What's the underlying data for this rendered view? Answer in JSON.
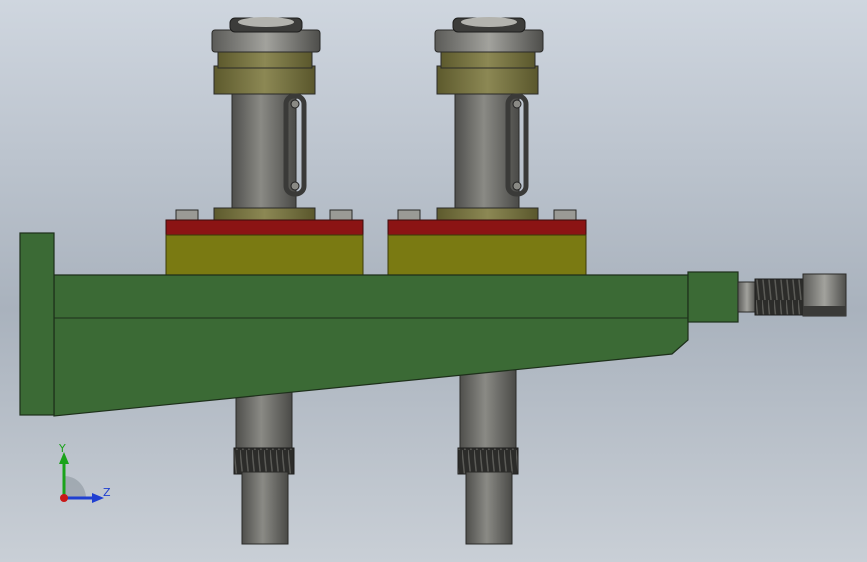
{
  "viewport": {
    "background_top": "#cfd6df",
    "background_bottom": "#a9b2bd"
  },
  "model": {
    "colors": {
      "frame_green": "#3a6b35",
      "block_olive": "#7a7a12",
      "plate_red": "#8b1414",
      "steel_gray": "#6e6e6a",
      "dark_steel": "#3a3a38",
      "collar_olive": "#77733f"
    }
  },
  "triad": {
    "y_label": "Y",
    "z_label": "Z",
    "y_color": "#1aa31a",
    "z_color": "#1f3fd1",
    "origin_color": "#c81818"
  }
}
